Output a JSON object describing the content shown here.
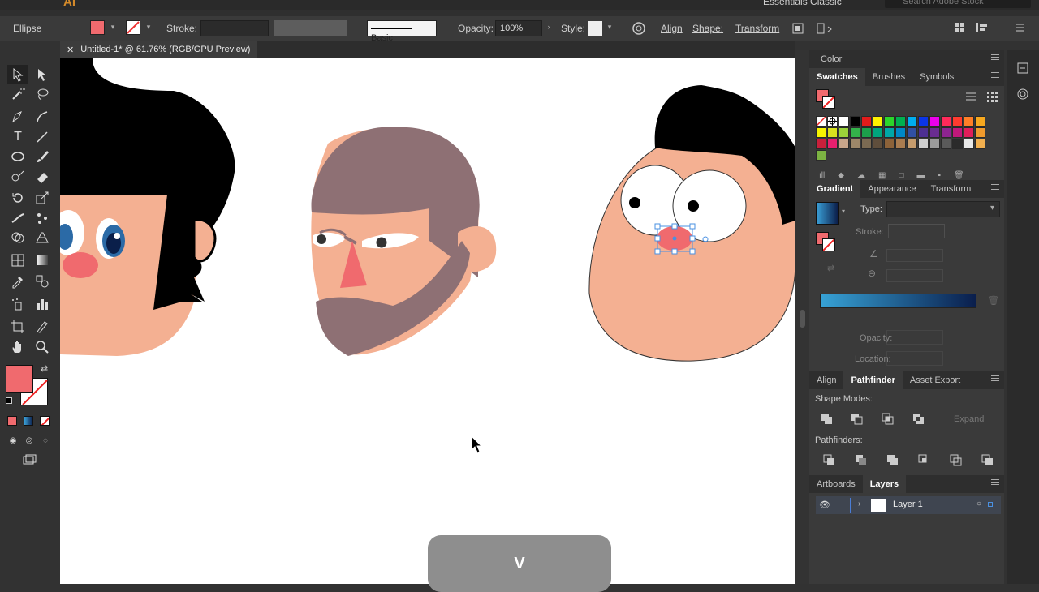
{
  "app": {
    "logo": "Ai",
    "workspace": "Essentials Classic",
    "search_placeholder": "Search Adobe Stock"
  },
  "controlbar": {
    "selection_type": "Ellipse",
    "fill_color": "#f06a6e",
    "stroke_label": "Stroke:",
    "brush_label": "Basic",
    "opacity_label": "Opacity:",
    "opacity_value": "100%",
    "style_label": "Style:",
    "align_label": "Align",
    "shape_label": "Shape:",
    "transform_label": "Transform"
  },
  "document": {
    "tab_title": "Untitled-1* @ 61.76% (RGB/GPU Preview)"
  },
  "panels": {
    "color_panel": {
      "tab": "Color"
    },
    "swatch_panel": {
      "tabs": [
        "Swatches",
        "Brushes",
        "Symbols"
      ]
    },
    "gradient_panel": {
      "tabs": [
        "Gradient",
        "Appearance",
        "Transform"
      ],
      "type_label": "Type:",
      "stroke_label": "Stroke:",
      "opacity_label": "Opacity:",
      "location_label": "Location:"
    },
    "pathfinder_panel": {
      "tabs": [
        "Align",
        "Pathfinder",
        "Asset Export"
      ],
      "shape_modes_label": "Shape Modes:",
      "expand_label": "Expand",
      "pathfinders_label": "Pathfinders:"
    },
    "layers_panel": {
      "tabs": [
        "Artboards",
        "Layers"
      ],
      "layers": [
        {
          "name": "Layer 1"
        }
      ]
    }
  },
  "key_overlay": "V",
  "colors": {
    "fill": "#f06a6e",
    "skin": "#f4b092",
    "beard": "#8e7074",
    "hair": "#000000",
    "accent_blue": "#4a90e2"
  }
}
